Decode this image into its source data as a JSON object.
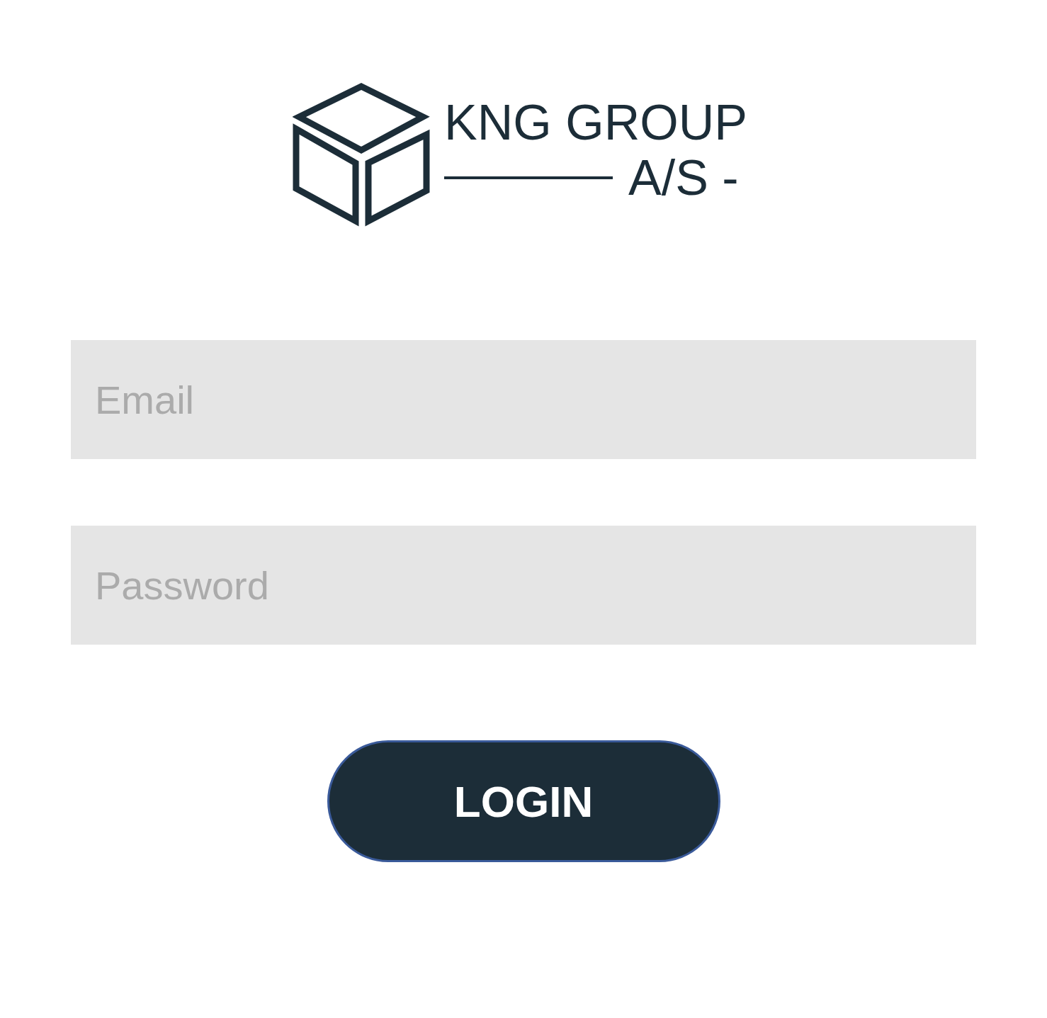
{
  "logo": {
    "name": "KNG GROUP",
    "suffix": "A/S -"
  },
  "fields": [
    {
      "placeholder": "Email"
    },
    {
      "placeholder": "Password"
    }
  ],
  "login_button": {
    "label": "LOGIN"
  }
}
